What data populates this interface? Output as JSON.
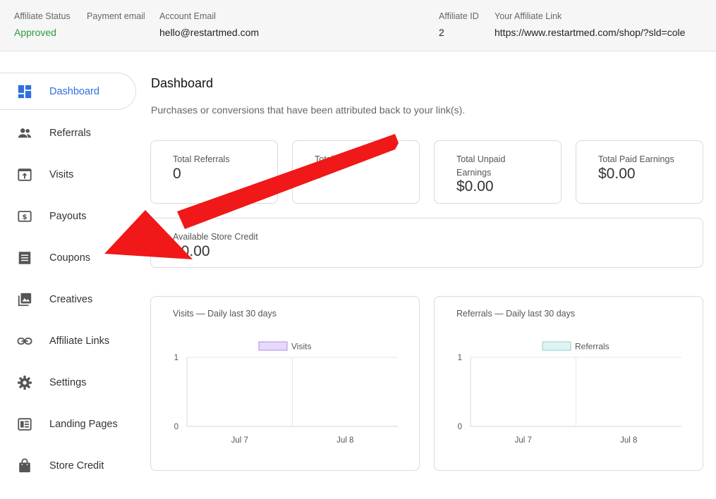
{
  "header": {
    "affiliate_status_label": "Affiliate Status",
    "affiliate_status_value": "Approved",
    "payment_email_label": "Payment email",
    "account_email_label": "Account Email",
    "account_email_value": "hello@restartmed.com",
    "affiliate_id_label": "Affiliate ID",
    "affiliate_id_value": "2",
    "affiliate_link_label": "Your Affiliate Link",
    "affiliate_link_value": "https://www.restartmed.com/shop/?sld=cole"
  },
  "sidebar": {
    "items": [
      {
        "label": "Dashboard",
        "icon": "dashboard-icon",
        "active": true
      },
      {
        "label": "Referrals",
        "icon": "people-icon"
      },
      {
        "label": "Visits",
        "icon": "visits-icon"
      },
      {
        "label": "Payouts",
        "icon": "dollar-icon"
      },
      {
        "label": "Coupons",
        "icon": "coupon-icon"
      },
      {
        "label": "Creatives",
        "icon": "image-icon"
      },
      {
        "label": "Affiliate Links",
        "icon": "link-icon"
      },
      {
        "label": "Settings",
        "icon": "gear-icon"
      },
      {
        "label": "Landing Pages",
        "icon": "landing-page-icon"
      },
      {
        "label": "Store Credit",
        "icon": "bag-icon"
      }
    ]
  },
  "main": {
    "title": "Dashboard",
    "description": "Purchases or conversions that have been attributed back to your link(s).",
    "stats": [
      {
        "label": "Total Referrals",
        "value": "0"
      },
      {
        "label": "Total Visits",
        "value": "0"
      },
      {
        "label": "Total Unpaid Earnings",
        "value": "$0.00"
      },
      {
        "label": "Total Paid Earnings",
        "value": "$0.00"
      }
    ],
    "store_credit": {
      "label": "Available Store Credit",
      "value": "$0.00"
    }
  },
  "chart_data": [
    {
      "type": "bar",
      "title": "Visits — Daily last 30 days",
      "categories": [
        "Jul 7",
        "Jul 8"
      ],
      "series": [
        {
          "name": "Visits",
          "values": [
            0,
            0
          ],
          "color": "#e6d9fb",
          "border": "#b08cf0"
        }
      ],
      "ylim": [
        0,
        1
      ],
      "yticks": [
        "1",
        "0"
      ],
      "legend": "top-center",
      "grid": true
    },
    {
      "type": "bar",
      "title": "Referrals — Daily last 30 days",
      "categories": [
        "Jul 7",
        "Jul 8"
      ],
      "series": [
        {
          "name": "Referrals",
          "values": [
            0,
            0
          ],
          "color": "#dff3f3",
          "border": "#8fd0d0"
        }
      ],
      "ylim": [
        0,
        1
      ],
      "yticks": [
        "1",
        "0"
      ],
      "legend": "top-center",
      "grid": true
    }
  ],
  "colors": {
    "accent": "#2f6fde",
    "approved": "#2a9d3a",
    "arrow": "#f01818"
  }
}
